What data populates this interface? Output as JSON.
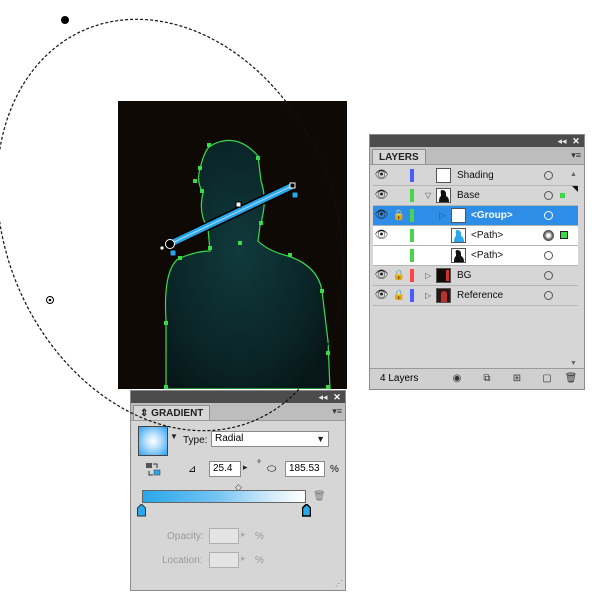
{
  "layers_panel": {
    "collapse_glyph": "◂◂",
    "close_glyph": "✕",
    "tab_label": "LAYERS",
    "menu_glyph": "▾≡",
    "rows": [
      {
        "name": "Shading",
        "color": "#4a5cff",
        "eye": "👁",
        "lock": "",
        "expand": ""
      },
      {
        "name": "Base",
        "color": "#4ad44a",
        "eye": "👁",
        "lock": "",
        "expand": "▽"
      },
      {
        "name": "<Group>",
        "color": "#4ad44a",
        "eye": "👁",
        "lock": "🔒",
        "expand": "▷"
      },
      {
        "name": "<Path>",
        "color": "#4ad44a",
        "eye": "👁",
        "lock": "",
        "expand": ""
      },
      {
        "name": "<Path>",
        "color": "#4ad44a",
        "eye": "",
        "lock": "",
        "expand": ""
      },
      {
        "name": "BG",
        "color": "#ff4444",
        "eye": "👁",
        "lock": "🔒",
        "expand": "▷"
      },
      {
        "name": "Reference",
        "color": "#4a5cff",
        "eye": "👁",
        "lock": "🔒",
        "expand": "▷"
      }
    ],
    "footer_count": "4 Layers"
  },
  "gradient_panel": {
    "collapse_glyph": "◂◂",
    "close_glyph": "✕",
    "tab_label": "GRADIENT",
    "tab_prefix": "⇕",
    "menu_glyph": "▾≡",
    "type_label": "Type:",
    "type_value": "Radial",
    "angle_value": "25.4",
    "aspect_value": "185.53",
    "percent_sign": "%",
    "degree_sign": "°",
    "opacity_label": "Opacity:",
    "location_label": "Location:",
    "opacity_unit": "%",
    "location_unit": "%",
    "delete_glyph": "🗑",
    "resize_glyph": "⋰"
  },
  "colors": {
    "selection_blue": "#2e8de6",
    "anchor_green": "#3bd94a",
    "gradient_start": "#2aa7ea",
    "gradient_end": "#ffffff",
    "panel_bg": "#d6d6d6"
  }
}
